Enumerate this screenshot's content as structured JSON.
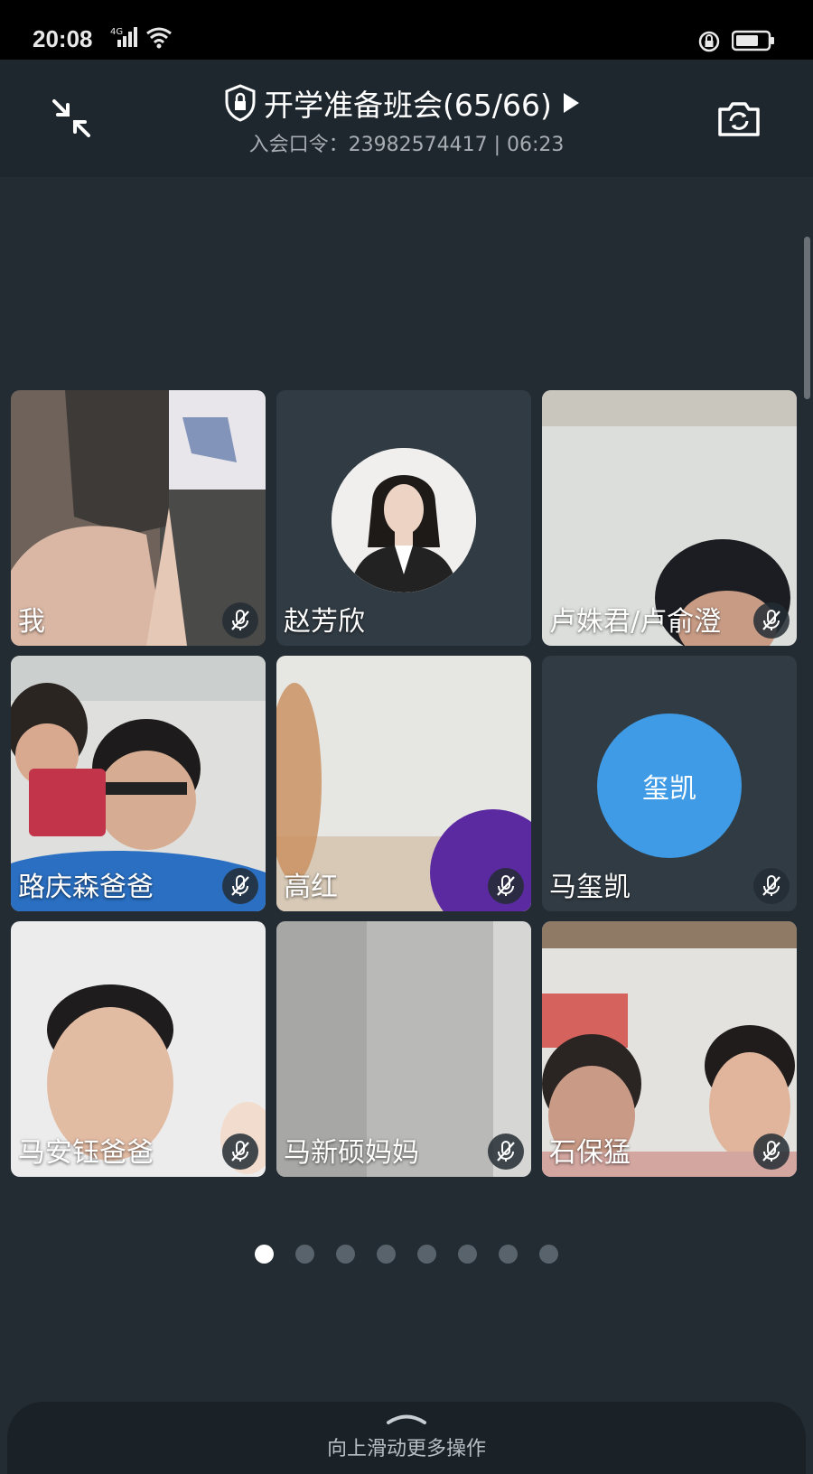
{
  "status": {
    "time": "20:08",
    "network": "4G"
  },
  "header": {
    "title": "开学准备班会(65/66)",
    "subtitle": "入会口令：23982574417 | 06:23"
  },
  "participants": [
    {
      "name": "我",
      "muted": true
    },
    {
      "name": "赵芳欣",
      "muted": false
    },
    {
      "name": "卢姝君/卢俞澄",
      "muted": true
    },
    {
      "name": "路庆森爸爸",
      "muted": true
    },
    {
      "name": "高红",
      "muted": true
    },
    {
      "name": "马玺凯",
      "muted": true,
      "avatar_text": "玺凯"
    },
    {
      "name": "马安钰爸爸",
      "muted": true
    },
    {
      "name": "马新硕妈妈",
      "muted": true
    },
    {
      "name": "石保猛",
      "muted": true
    }
  ],
  "pagination": {
    "total": 8,
    "current": 1
  },
  "bottom_sheet": {
    "hint": "向上滑动更多操作"
  },
  "colors": {
    "background": "#232c33",
    "header": "#1e272e",
    "tile": "#313b43",
    "avatar_blue": "#3f9be6"
  }
}
